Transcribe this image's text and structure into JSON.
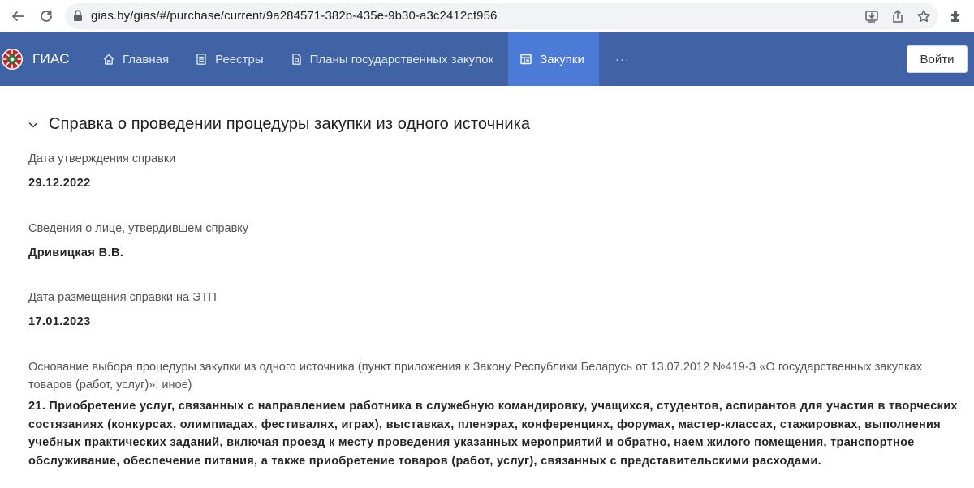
{
  "browser": {
    "url": "gias.by/gias/#/purchase/current/9a284571-382b-435e-9b30-a3c2412cf956",
    "icons": [
      "back-arrow-icon",
      "reload-icon",
      "lock-icon",
      "install-icon",
      "share-icon",
      "bookmark-star-icon",
      "extensions-icon"
    ]
  },
  "header": {
    "brand": "ГИАС",
    "nav": [
      {
        "label": "Главная",
        "icon": "home-icon"
      },
      {
        "label": "Реестры",
        "icon": "registry-icon"
      },
      {
        "label": "Планы государственных закупок",
        "icon": "plan-icon"
      },
      {
        "label": "Закупки",
        "icon": "purchase-icon",
        "active": true
      }
    ],
    "more": "···",
    "login": "Войти",
    "colors": {
      "bar": "#3f63a4",
      "active": "#4b7bd6"
    }
  },
  "section": {
    "title": "Справка о проведении процедуры закупки из одного источника",
    "fields": [
      {
        "label": "Дата утверждения справки",
        "value": "29.12.2022"
      },
      {
        "label": "Сведения о лице, утвердившем справку",
        "value": "Дривицкая В.В."
      },
      {
        "label": "Дата размещения справки на ЭТП",
        "value": "17.01.2023"
      },
      {
        "label": "Основание выбора процедуры закупки из одного источника (пункт приложения к Закону Республики Беларусь от 13.07.2012 №419-З «О государственных закупках товаров (работ, услуг)»; иное)",
        "value": "21. Приобретение услуг, связанных с направлением работника в служебную командировку, учащихся, студентов, аспирантов для участия в творческих состязаниях (конкурсах, олимпиадах, фестивалях, играх), выставках, пленэрах, конференциях, форумах, мастер-классах, стажировках, выполнения учебных практических заданий, включая проезд к месту проведения указанных мероприятий и обратно, наем жилого помещения, транспортное обслуживание, обеспечение питания, а также приобретение товаров (работ, услуг), связанных с представительскими расходами."
      }
    ]
  }
}
